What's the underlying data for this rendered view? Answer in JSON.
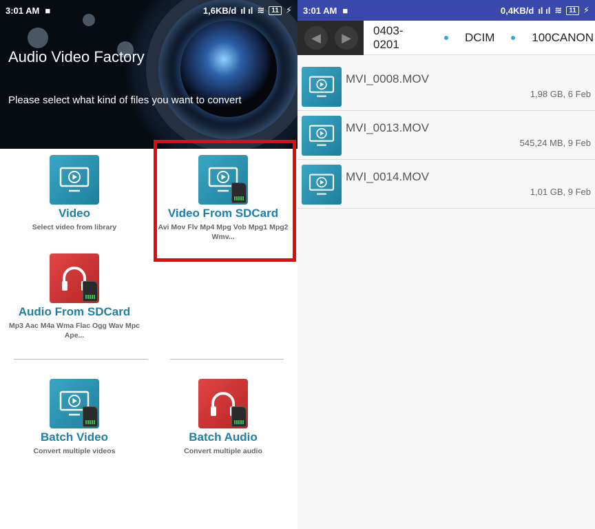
{
  "left": {
    "status": {
      "time": "3:01 AM",
      "speed": "1,6KB/d",
      "battery": "11"
    },
    "title": "Audio Video Factory",
    "subtitle": "Please select what kind of files you want to convert",
    "tiles": {
      "video": {
        "title": "Video",
        "sub": "Select video from library",
        "icon": "monitor-play-icon"
      },
      "video_sd": {
        "title": "Video From SDCard",
        "sub": "Avi Mov Flv Mp4 Mpg Vob Mpg1 Mpg2 Wmv...",
        "icon": "monitor-play-sdcard-icon"
      },
      "audio_sd": {
        "title": "Audio From SDCard",
        "sub": "Mp3 Aac M4a Wma Flac Ogg Wav Mpc Ape...",
        "icon": "headphones-sdcard-icon"
      },
      "batch_video": {
        "title": "Batch Video",
        "sub": "Convert multiple videos",
        "icon": "monitor-play-sdcard-icon"
      },
      "batch_audio": {
        "title": "Batch Audio",
        "sub": "Convert multiple audio",
        "icon": "headphones-sdcard-icon"
      }
    }
  },
  "right": {
    "status": {
      "time": "3:01 AM",
      "speed": "0,4KB/d",
      "battery": "11"
    },
    "breadcrumbs": [
      "0403-0201",
      "DCIM",
      "100CANON"
    ],
    "files": [
      {
        "name": "MVI_0008.MOV",
        "meta": "1,98 GB, 6 Feb"
      },
      {
        "name": "MVI_0013.MOV",
        "meta": "545,24 MB, 9 Feb"
      },
      {
        "name": "MVI_0014.MOV",
        "meta": "1,01 GB, 9 Feb"
      }
    ]
  },
  "colors": {
    "teal": "#1e7fa6",
    "red": "#c62828",
    "highlight": "#e30b0b",
    "status_right": "#3949ab"
  }
}
